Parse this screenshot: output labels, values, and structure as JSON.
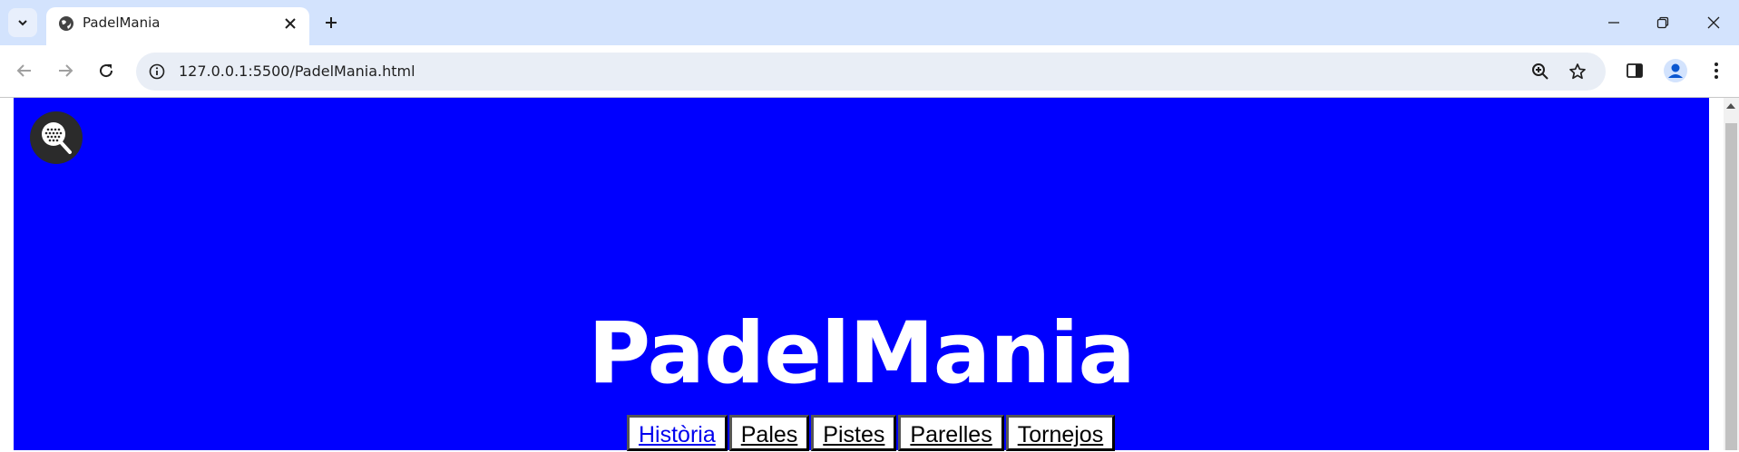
{
  "browser": {
    "tab_title": "PadelMania",
    "url": "127.0.0.1:5500/PadelMania.html",
    "icons": {
      "tab_search": "chevron-down-icon",
      "favicon": "globe-icon",
      "tab_close": "close-icon",
      "new_tab": "plus-icon",
      "minimize": "minimize-icon",
      "restore": "restore-icon",
      "close_window": "close-icon",
      "back": "back-arrow-icon",
      "forward": "forward-arrow-icon",
      "reload": "reload-icon",
      "site_info": "info-icon",
      "zoom": "zoom-icon",
      "bookmark": "star-icon",
      "side_panel": "side-panel-icon",
      "profile": "avatar-icon",
      "menu": "kebab-menu-icon"
    }
  },
  "page": {
    "title": "PadelMania",
    "background_color": "#0000ff",
    "logo_icon": "padel-racket-icon",
    "menu": [
      {
        "label": "Història",
        "visited": true
      },
      {
        "label": "Pales",
        "visited": false
      },
      {
        "label": "Pistes",
        "visited": false
      },
      {
        "label": "Parelles",
        "visited": false
      },
      {
        "label": "Tornejos",
        "visited": false
      }
    ]
  }
}
